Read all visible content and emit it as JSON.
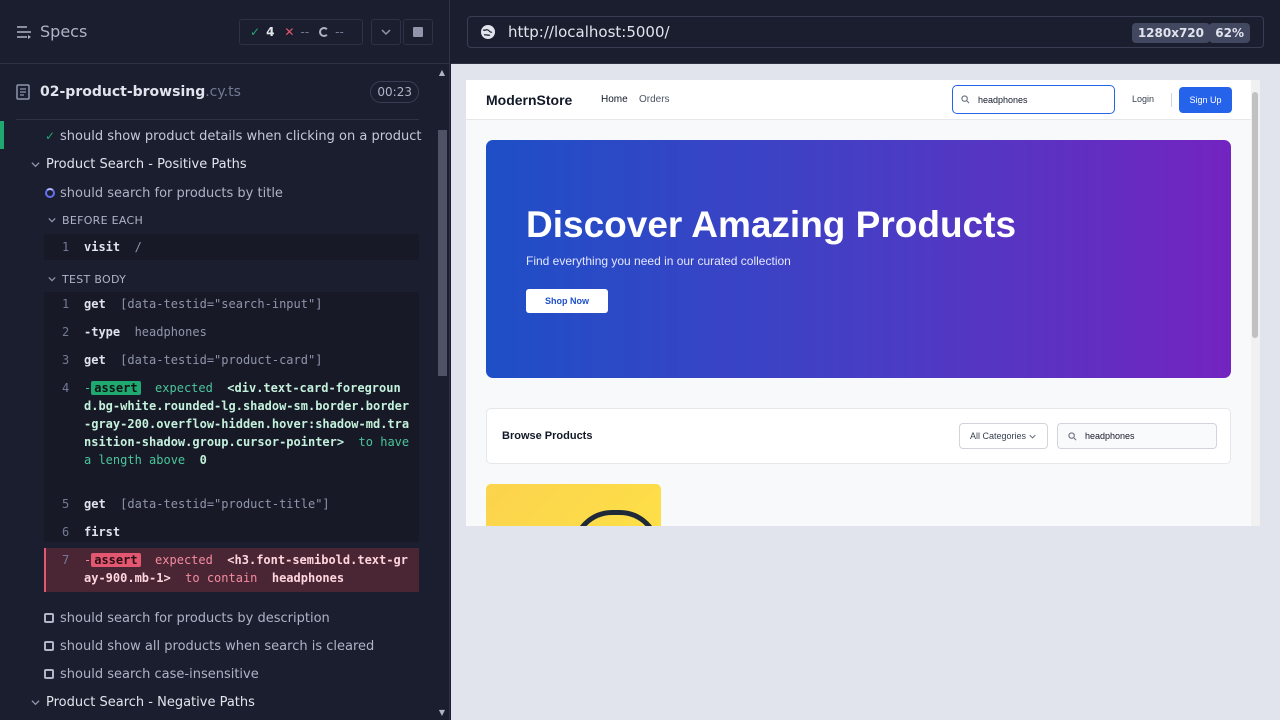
{
  "reporter": {
    "title": "Specs",
    "stats": {
      "passed": "4",
      "failed": "--",
      "pending": "--"
    },
    "spec": {
      "name": "02-product-browsing",
      "ext": ".cy.ts",
      "time": "00:23"
    },
    "items": {
      "t_details": "should show product details when clicking on a product",
      "suite_positive": "Product Search - Positive Paths",
      "t_title": "should search for products by title",
      "hook_before": "BEFORE EACH",
      "hook_body": "TEST BODY",
      "t_description": "should search for products by description",
      "t_cleared": "should show all products when search is cleared",
      "t_case": "should search case-insensitive",
      "suite_negative": "Product Search - Negative Paths"
    },
    "before_cmd": {
      "num": "1",
      "name": "visit",
      "arg": "/"
    },
    "commands": [
      {
        "num": "1",
        "name": "get",
        "arg": "[data-testid=\"search-input\"]"
      },
      {
        "num": "2",
        "name": "-type",
        "arg": "headphones"
      },
      {
        "num": "3",
        "name": "get",
        "arg": "[data-testid=\"product-card\"]"
      },
      {
        "num": "4",
        "prefix": "-",
        "badge": "assert",
        "text1": "expected",
        "el": "<div.text-card-foreground.bg-white.rounded-lg.shadow-sm.border.border-gray-200.overflow-hidden.hover:shadow-md.transition-shadow.group.cursor-pointer>",
        "text2": "to have a length above",
        "val": "0"
      },
      {
        "num": "5",
        "name": "get",
        "arg": "[data-testid=\"product-title\"]"
      },
      {
        "num": "6",
        "name": "first",
        "arg": ""
      },
      {
        "num": "7",
        "prefix": "-",
        "badge": "assert",
        "text1": "expected",
        "el": "<h3.font-semibold.text-gray-900.mb-1>",
        "text2": "to contain",
        "val": "headphones"
      }
    ]
  },
  "aut": {
    "url": "http://localhost:5000/",
    "viewport": "1280x720",
    "zoom": "62%",
    "app": {
      "logo": "ModernStore",
      "nav_home": "Home",
      "nav_orders": "Orders",
      "search_value": "headphones",
      "login": "Login",
      "signup": "Sign Up",
      "hero_title": "Discover Amazing Products",
      "hero_subtitle": "Find everything you need in our curated collection",
      "hero_button": "Shop Now",
      "browse_title": "Browse Products",
      "category": "All Categories",
      "browse_search_value": "headphones"
    }
  },
  "colors": {
    "pass": "#1fa971",
    "fail": "#e45770",
    "brand": "#2563eb"
  }
}
